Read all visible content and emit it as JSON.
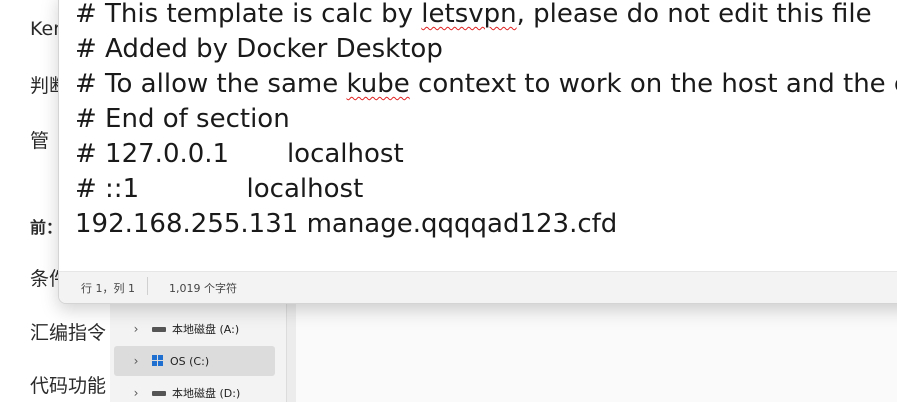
{
  "background_document": {
    "lines": [
      "Ker",
      "判断",
      "管",
      "前：",
      "条件",
      "汇编指令",
      "代码功能"
    ]
  },
  "file_explorer": {
    "tree_mark": "↑",
    "items": [
      {
        "label": "本地磁盘 (A:)",
        "icon": "drive-icon",
        "selected": false
      },
      {
        "label": "OS (C:)",
        "icon": "windows-drive-icon",
        "selected": true
      },
      {
        "label": "本地磁盘 (D:)",
        "icon": "drive-icon",
        "selected": false
      }
    ]
  },
  "notepad": {
    "lines": [
      {
        "text": "# This template is calc by ",
        "squiggle": "letsvpn",
        "rest": ", please do not edit this file"
      },
      {
        "text": "# Added by Docker Desktop",
        "squiggle": "",
        "rest": ""
      },
      {
        "text": "# To allow the same ",
        "squiggle": "kube",
        "rest": " context to work on the host and the c"
      },
      {
        "text": "# End of section",
        "squiggle": "",
        "rest": ""
      },
      {
        "text": "# 127.0.0.1       localhost",
        "squiggle": "",
        "rest": ""
      },
      {
        "text": "# ::1             localhost",
        "squiggle": "",
        "rest": ""
      },
      {
        "text": "192.168.255.131 manage.qqqqad123.cfd",
        "squiggle": "",
        "rest": ""
      }
    ],
    "status": {
      "position": "行 1，列 1",
      "char_count": "1,019 个字符"
    }
  }
}
